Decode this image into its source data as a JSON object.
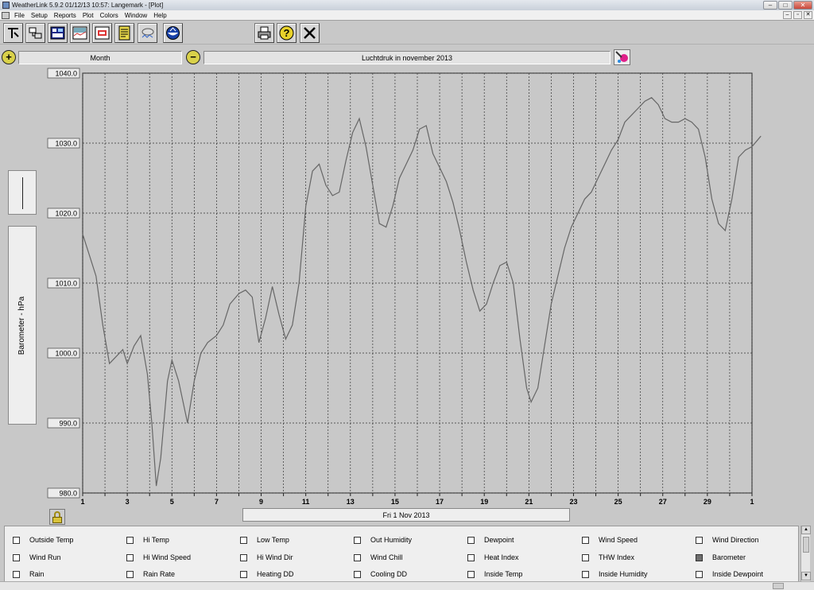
{
  "window": {
    "title": "WeatherLink 5.9.2  01/12/13  10:57: Langemark - [Plot]",
    "buttons": {
      "minimize": "–",
      "maximize": "□",
      "close": "✕"
    }
  },
  "menu": {
    "items": [
      "File",
      "Setup",
      "Reports",
      "Plot",
      "Colors",
      "Window",
      "Help"
    ],
    "mdi": {
      "minimize": "–",
      "restore": "▫",
      "close": "✕"
    }
  },
  "toolbar": {
    "buttons": [
      {
        "name": "connect-tool-button",
        "icon": "connect-icon"
      },
      {
        "name": "download-tool-button",
        "icon": "download-icon"
      },
      {
        "name": "bulletin-tool-button",
        "icon": "bulletin-icon"
      },
      {
        "name": "summary-tool-button",
        "icon": "summary-icon"
      },
      {
        "name": "plot-tool-button",
        "icon": "plot-icon"
      },
      {
        "name": "browse-tool-button",
        "icon": "notes-icon"
      },
      {
        "name": "strip-charts-tool-button",
        "icon": "weather-icon"
      },
      {
        "name": "noaa-tool-button",
        "icon": "noaa-icon"
      },
      {
        "name": "print-tool-button",
        "icon": "printer-icon"
      },
      {
        "name": "help-tool-button",
        "icon": "question-icon"
      },
      {
        "name": "close-tool-button",
        "icon": "close-icon"
      }
    ]
  },
  "plot_controls": {
    "zoom_in": "+",
    "zoom_out": "−",
    "period": "Month",
    "title": "Luchtdruk in november 2013"
  },
  "yaxis_label": "Barometer - hPa",
  "date_field": "Fri 1 Nov 2013",
  "colors": {
    "plot_bg": "#c8c8c8",
    "line": "#666666",
    "grid": "#333333"
  },
  "chart_data": {
    "type": "line",
    "title": "Luchtdruk in november 2013",
    "ylabel": "Barometer - hPa",
    "xlabel": "",
    "ylim": [
      980,
      1040
    ],
    "xlim": [
      1,
      31
    ],
    "yticks": [
      980,
      990,
      1000,
      1010,
      1020,
      1030,
      1040
    ],
    "ytick_labels": [
      "980.0",
      "990.0",
      "1000.0",
      "1010.0",
      "1020.0",
      "1030.0",
      "1040.0"
    ],
    "xtick_labels": [
      "1",
      "3",
      "5",
      "7",
      "9",
      "11",
      "13",
      "15",
      "17",
      "19",
      "21",
      "23",
      "25",
      "27",
      "29",
      "1"
    ],
    "grid": true,
    "series": [
      {
        "x": [
          1.0,
          1.3,
          1.6,
          1.9,
          2.2,
          2.5,
          2.8,
          3.0,
          3.3,
          3.6,
          3.9,
          4.1,
          4.3,
          4.5,
          4.8,
          5.0,
          5.3,
          5.5,
          5.7,
          6.0,
          6.3,
          6.6,
          7.0,
          7.3,
          7.6,
          8.0,
          8.3,
          8.6,
          8.9,
          9.2,
          9.5,
          9.8,
          10.1,
          10.4,
          10.7,
          11.0,
          11.3,
          11.6,
          11.9,
          12.2,
          12.5,
          12.8,
          13.1,
          13.4,
          13.7,
          14.0,
          14.3,
          14.6,
          14.9,
          15.2,
          15.5,
          15.8,
          16.1,
          16.4,
          16.7,
          17.0,
          17.3,
          17.6,
          17.9,
          18.2,
          18.5,
          18.8,
          19.1,
          19.4,
          19.7,
          20.0,
          20.3,
          20.6,
          20.9,
          21.1,
          21.4,
          21.7,
          22.0,
          22.3,
          22.6,
          22.9,
          23.2,
          23.5,
          23.8,
          24.1,
          24.4,
          24.7,
          25.0,
          25.3,
          25.6,
          25.9,
          26.2,
          26.5,
          26.8,
          27.1,
          27.4,
          27.7,
          28.0,
          28.3,
          28.6,
          28.9,
          29.2,
          29.5,
          29.8,
          30.1,
          30.4,
          30.7,
          31.0,
          31.4
        ],
        "y": [
          1017,
          1014,
          1011,
          1004,
          998.5,
          999.5,
          1000.5,
          998.5,
          1001,
          1002.5,
          997,
          990,
          981,
          985,
          996,
          999,
          996,
          993,
          990,
          996,
          1000,
          1001.5,
          1002.5,
          1004,
          1007,
          1008.5,
          1009,
          1008,
          1001.5,
          1005,
          1009.5,
          1005.5,
          1002,
          1004,
          1010,
          1021,
          1026,
          1027,
          1024,
          1022.5,
          1023,
          1027.5,
          1031.5,
          1033.5,
          1029.5,
          1024,
          1018.5,
          1018,
          1021,
          1025,
          1027,
          1029,
          1032,
          1032.5,
          1028.5,
          1026.5,
          1024.5,
          1021.5,
          1017.5,
          1013,
          1009,
          1006,
          1007,
          1010,
          1012.5,
          1013,
          1010,
          1002,
          995,
          993,
          995,
          1001,
          1007,
          1011,
          1015,
          1018,
          1020,
          1022,
          1023,
          1025,
          1027,
          1029,
          1030.5,
          1033,
          1034,
          1035,
          1036,
          1036.5,
          1035.5,
          1033.5,
          1033,
          1033,
          1033.5,
          1033,
          1032,
          1028,
          1022,
          1018.5,
          1017.5,
          1022,
          1028,
          1029,
          1029.5,
          1031
        ]
      }
    ]
  },
  "channels": [
    [
      "Outside Temp",
      "Hi Temp",
      "Low Temp",
      "Out Humidity",
      "Dewpoint",
      "Wind Speed",
      "Wind Direction"
    ],
    [
      "Wind Run",
      "Hi Wind Speed",
      "Hi Wind Dir",
      "Wind Chill",
      "Heat Index",
      "THW Index",
      "Barometer"
    ],
    [
      "Rain",
      "Rain Rate",
      "Heating DD",
      "Cooling DD",
      "Inside Temp",
      "Inside Humidity",
      "Inside Dewpoint"
    ]
  ],
  "checked_channel": "Barometer"
}
